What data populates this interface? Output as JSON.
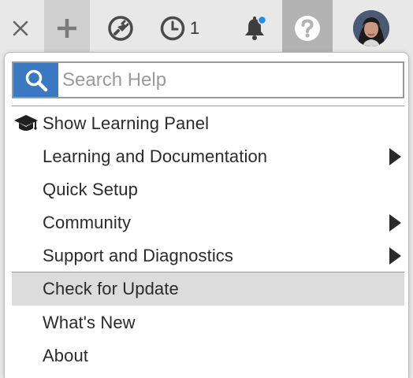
{
  "toolbar": {
    "close_icon": "close-icon",
    "add_icon": "plus-icon",
    "plugin_icon": "plugin-icon",
    "history_icon": "clock-icon",
    "history_count": "1",
    "bell_icon": "bell-icon",
    "bell_dot_color": "#1e8fe3",
    "help_icon": "question-icon",
    "avatar": "user-avatar"
  },
  "help_menu": {
    "search": {
      "placeholder": "Search Help",
      "value": "",
      "icon": "search-icon",
      "icon_bg": "#3a78c2"
    },
    "items": [
      {
        "label": "Show Learning Panel",
        "icon": "graduation-cap-icon",
        "submenu": false,
        "highlighted": false
      },
      {
        "label": "Learning and Documentation",
        "submenu": true,
        "highlighted": false
      },
      {
        "label": "Quick Setup",
        "submenu": false,
        "highlighted": false
      },
      {
        "label": "Community",
        "submenu": true,
        "highlighted": false
      },
      {
        "label": "Support and Diagnostics",
        "submenu": true,
        "highlighted": false
      },
      {
        "label": "Check for Update",
        "submenu": false,
        "highlighted": true
      },
      {
        "label": "What's New",
        "submenu": false,
        "highlighted": false
      },
      {
        "label": "About",
        "submenu": false,
        "highlighted": false
      }
    ]
  }
}
